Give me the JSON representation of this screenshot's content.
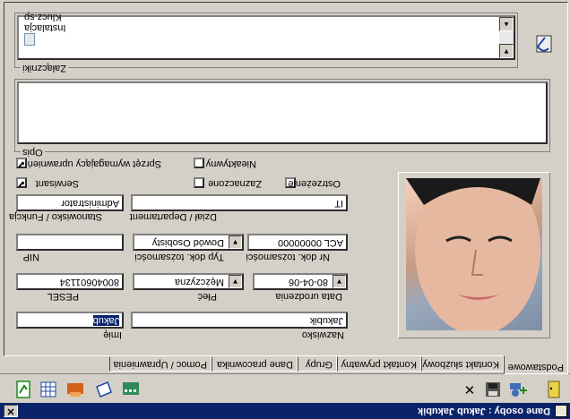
{
  "window": {
    "title": "Dane osoby : Jakub Jakubik"
  },
  "tabs": [
    "Podstawowe",
    "Kontakt służbowy",
    "Kontakt prywatny",
    "Grupy",
    "Dane pracownika",
    "Pomoc / Uprawnienia"
  ],
  "form": {
    "imie_label": "Imię",
    "imie_value": "Jakub",
    "nazwisko_label": "Nazwisko",
    "nazwisko_value": "Jakubik",
    "pesel_label": "PESEL",
    "pesel_value": "80040601134",
    "plec_label": "Płeć",
    "plec_value": "Mężczyzna",
    "data_label": "Data urodzenia",
    "data_value": "80-04-06",
    "nip_label": "NIP",
    "nip_value": "",
    "typdok_label": "Typ dok. tożsamości",
    "typdok_value": "Dowód Osobisty",
    "nrdok_label": "Nr dok. tożsamości",
    "nrdok_value": "ACL 00000000",
    "stanowisko_label": "Stanowisko / Funkcja",
    "stanowisko_value": "Administrator",
    "dzial_label": "Dział / Departament",
    "dzial_value": "IT"
  },
  "checkboxes": {
    "serwisant": {
      "label": "Serwisant",
      "checked": true
    },
    "sprzet": {
      "label": "Sprzęt wymagający uprawnień",
      "checked": true
    },
    "nieaktywny": {
      "label": "Nieaktywny",
      "checked": false
    },
    "zaznaczone": {
      "label": "Zaznaczone",
      "checked": false
    },
    "ostrzezenie": {
      "label": "Ostrzeżenie",
      "checked": false
    }
  },
  "opis": {
    "label": "Opis",
    "value": ""
  },
  "zalaczniki": {
    "label": "Załączniki",
    "items": [
      "Instalacja",
      "Klucz.sp"
    ]
  },
  "check_mark": "✔",
  "combo_arrow": "▼"
}
